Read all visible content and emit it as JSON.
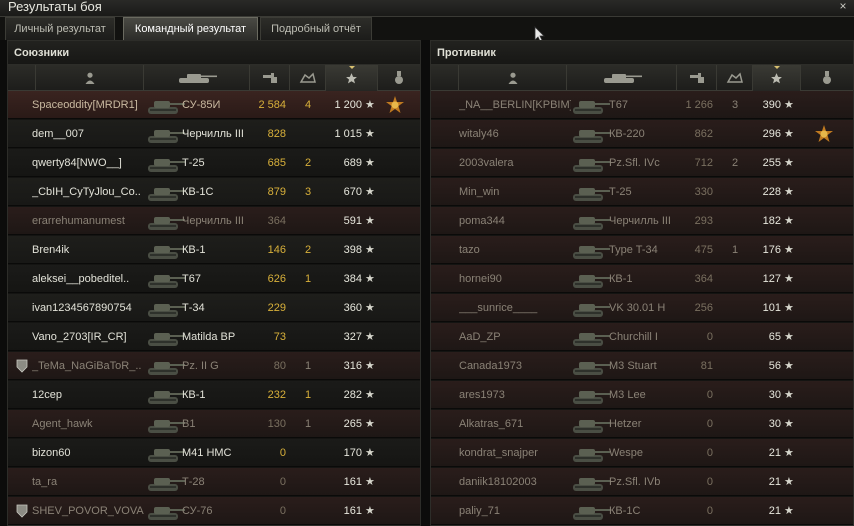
{
  "window": {
    "title": "Результаты боя",
    "close_glyph": "×"
  },
  "tabs": [
    {
      "label": "Личный результат",
      "active": false
    },
    {
      "label": "Командный результат",
      "active": true
    },
    {
      "label": "Подробный отчёт",
      "active": false
    }
  ],
  "allies": {
    "title": "Союзники",
    "header_icons": [
      "platoon-icon",
      "player-icon",
      "tank-icon",
      "damage-icon",
      "frags-icon",
      "score-star-icon",
      "medal-icon"
    ],
    "sorted_column": "score",
    "rows": [
      {
        "name": "Spaceoddity[MRDR1]",
        "vehicle": "СУ-85И",
        "damage": "2 584",
        "frags": "4",
        "score": "1 200",
        "state": "me",
        "platoon": false,
        "medal": true
      },
      {
        "name": "dem__007",
        "vehicle": "Черчилль III",
        "damage": "828",
        "frags": "",
        "score": "1 015",
        "state": "alive",
        "platoon": false,
        "medal": false
      },
      {
        "name": "qwerty84[NWO__]",
        "vehicle": "Т-25",
        "damage": "685",
        "frags": "2",
        "score": "689",
        "state": "alive",
        "platoon": false,
        "medal": false
      },
      {
        "name": "_CbIH_CyTyJlou_Co..",
        "vehicle": "КВ-1С",
        "damage": "879",
        "frags": "3",
        "score": "670",
        "state": "alive",
        "platoon": false,
        "medal": false
      },
      {
        "name": "erarrehumanumest",
        "vehicle": "Черчилль III",
        "damage": "364",
        "frags": "",
        "score": "591",
        "state": "dead",
        "platoon": false,
        "medal": false
      },
      {
        "name": "Bren4ik",
        "vehicle": "КВ-1",
        "damage": "146",
        "frags": "2",
        "score": "398",
        "state": "alive",
        "platoon": false,
        "medal": false
      },
      {
        "name": "aleksei__pobeditel..",
        "vehicle": "T67",
        "damage": "626",
        "frags": "1",
        "score": "384",
        "state": "alive",
        "platoon": false,
        "medal": false
      },
      {
        "name": "ivan1234567890754",
        "vehicle": "Т-34",
        "damage": "229",
        "frags": "",
        "score": "360",
        "state": "alive",
        "platoon": false,
        "medal": false
      },
      {
        "name": "Vano_2703[IR_CR]",
        "vehicle": "Matilda BP",
        "damage": "73",
        "frags": "",
        "score": "327",
        "state": "alive",
        "platoon": false,
        "medal": false
      },
      {
        "name": "_TeMa_NaGiBaToR_..",
        "vehicle": "Pz. II G",
        "damage": "80",
        "frags": "1",
        "score": "316",
        "state": "dead",
        "platoon": true,
        "medal": false
      },
      {
        "name": "12cep",
        "vehicle": "КВ-1",
        "damage": "232",
        "frags": "1",
        "score": "282",
        "state": "alive",
        "platoon": false,
        "medal": false
      },
      {
        "name": "Agent_hawk",
        "vehicle": "B1",
        "damage": "130",
        "frags": "1",
        "score": "265",
        "state": "dead",
        "platoon": false,
        "medal": false
      },
      {
        "name": "bizon60",
        "vehicle": "M41 HMC",
        "damage": "0",
        "frags": "",
        "score": "170",
        "state": "alive",
        "platoon": false,
        "medal": false
      },
      {
        "name": "ta_ra",
        "vehicle": "Т-28",
        "damage": "0",
        "frags": "",
        "score": "161",
        "state": "dead",
        "platoon": false,
        "medal": false
      },
      {
        "name": "SHEV_POVOR_VOVA..",
        "vehicle": "СУ-76",
        "damage": "0",
        "frags": "",
        "score": "161",
        "state": "dead",
        "platoon": true,
        "medal": false
      }
    ]
  },
  "enemies": {
    "title": "Противник",
    "header_icons": [
      "platoon-icon",
      "player-icon",
      "tank-icon",
      "damage-icon",
      "frags-icon",
      "score-star-icon",
      "medal-icon"
    ],
    "sorted_column": "score",
    "rows": [
      {
        "name": "_NA__BERLIN[KPBIM]",
        "vehicle": "T67",
        "damage": "1 266",
        "frags": "3",
        "score": "390",
        "state": "dead",
        "platoon": false,
        "medal": false
      },
      {
        "name": "witaly46",
        "vehicle": "КВ-220",
        "damage": "862",
        "frags": "",
        "score": "296",
        "state": "dead",
        "platoon": false,
        "medal": true
      },
      {
        "name": "2003valera",
        "vehicle": "Pz.Sfl. IVc",
        "damage": "712",
        "frags": "2",
        "score": "255",
        "state": "dead",
        "platoon": false,
        "medal": false
      },
      {
        "name": "Min_win",
        "vehicle": "Т-25",
        "damage": "330",
        "frags": "",
        "score": "228",
        "state": "dead",
        "platoon": false,
        "medal": false
      },
      {
        "name": "poma344",
        "vehicle": "Черчилль III",
        "damage": "293",
        "frags": "",
        "score": "182",
        "state": "dead",
        "platoon": false,
        "medal": false
      },
      {
        "name": "tazo",
        "vehicle": "Type T-34",
        "damage": "475",
        "frags": "1",
        "score": "176",
        "state": "dead",
        "platoon": false,
        "medal": false
      },
      {
        "name": "hornei90",
        "vehicle": "КВ-1",
        "damage": "364",
        "frags": "",
        "score": "127",
        "state": "dead",
        "platoon": false,
        "medal": false
      },
      {
        "name": "___sunrice____",
        "vehicle": "VK 30.01 H",
        "damage": "256",
        "frags": "",
        "score": "101",
        "state": "dead",
        "platoon": false,
        "medal": false
      },
      {
        "name": "AaD_ZP",
        "vehicle": "Churchill I",
        "damage": "0",
        "frags": "",
        "score": "65",
        "state": "dead",
        "platoon": false,
        "medal": false
      },
      {
        "name": "Canada1973",
        "vehicle": "M3 Stuart",
        "damage": "81",
        "frags": "",
        "score": "56",
        "state": "dead",
        "platoon": false,
        "medal": false
      },
      {
        "name": "ares1973",
        "vehicle": "M3 Lee",
        "damage": "0",
        "frags": "",
        "score": "30",
        "state": "dead",
        "platoon": false,
        "medal": false
      },
      {
        "name": "Alkatras_671",
        "vehicle": "Hetzer",
        "damage": "0",
        "frags": "",
        "score": "30",
        "state": "dead",
        "platoon": false,
        "medal": false
      },
      {
        "name": "kondrat_snajper",
        "vehicle": "Wespe",
        "damage": "0",
        "frags": "",
        "score": "21",
        "state": "dead",
        "platoon": false,
        "medal": false
      },
      {
        "name": "daniik18102003",
        "vehicle": "Pz.Sfl. IVb",
        "damage": "0",
        "frags": "",
        "score": "21",
        "state": "dead",
        "platoon": false,
        "medal": false
      },
      {
        "name": "paliy_71",
        "vehicle": "КВ-1С",
        "damage": "0",
        "frags": "",
        "score": "21",
        "state": "dead",
        "platoon": false,
        "medal": false
      }
    ]
  },
  "colors": {
    "damage": "#d8b03a",
    "self_row": "#3a2420",
    "destroyed_row": "#2a1d1b",
    "accent_star": "#d6d6cc"
  }
}
